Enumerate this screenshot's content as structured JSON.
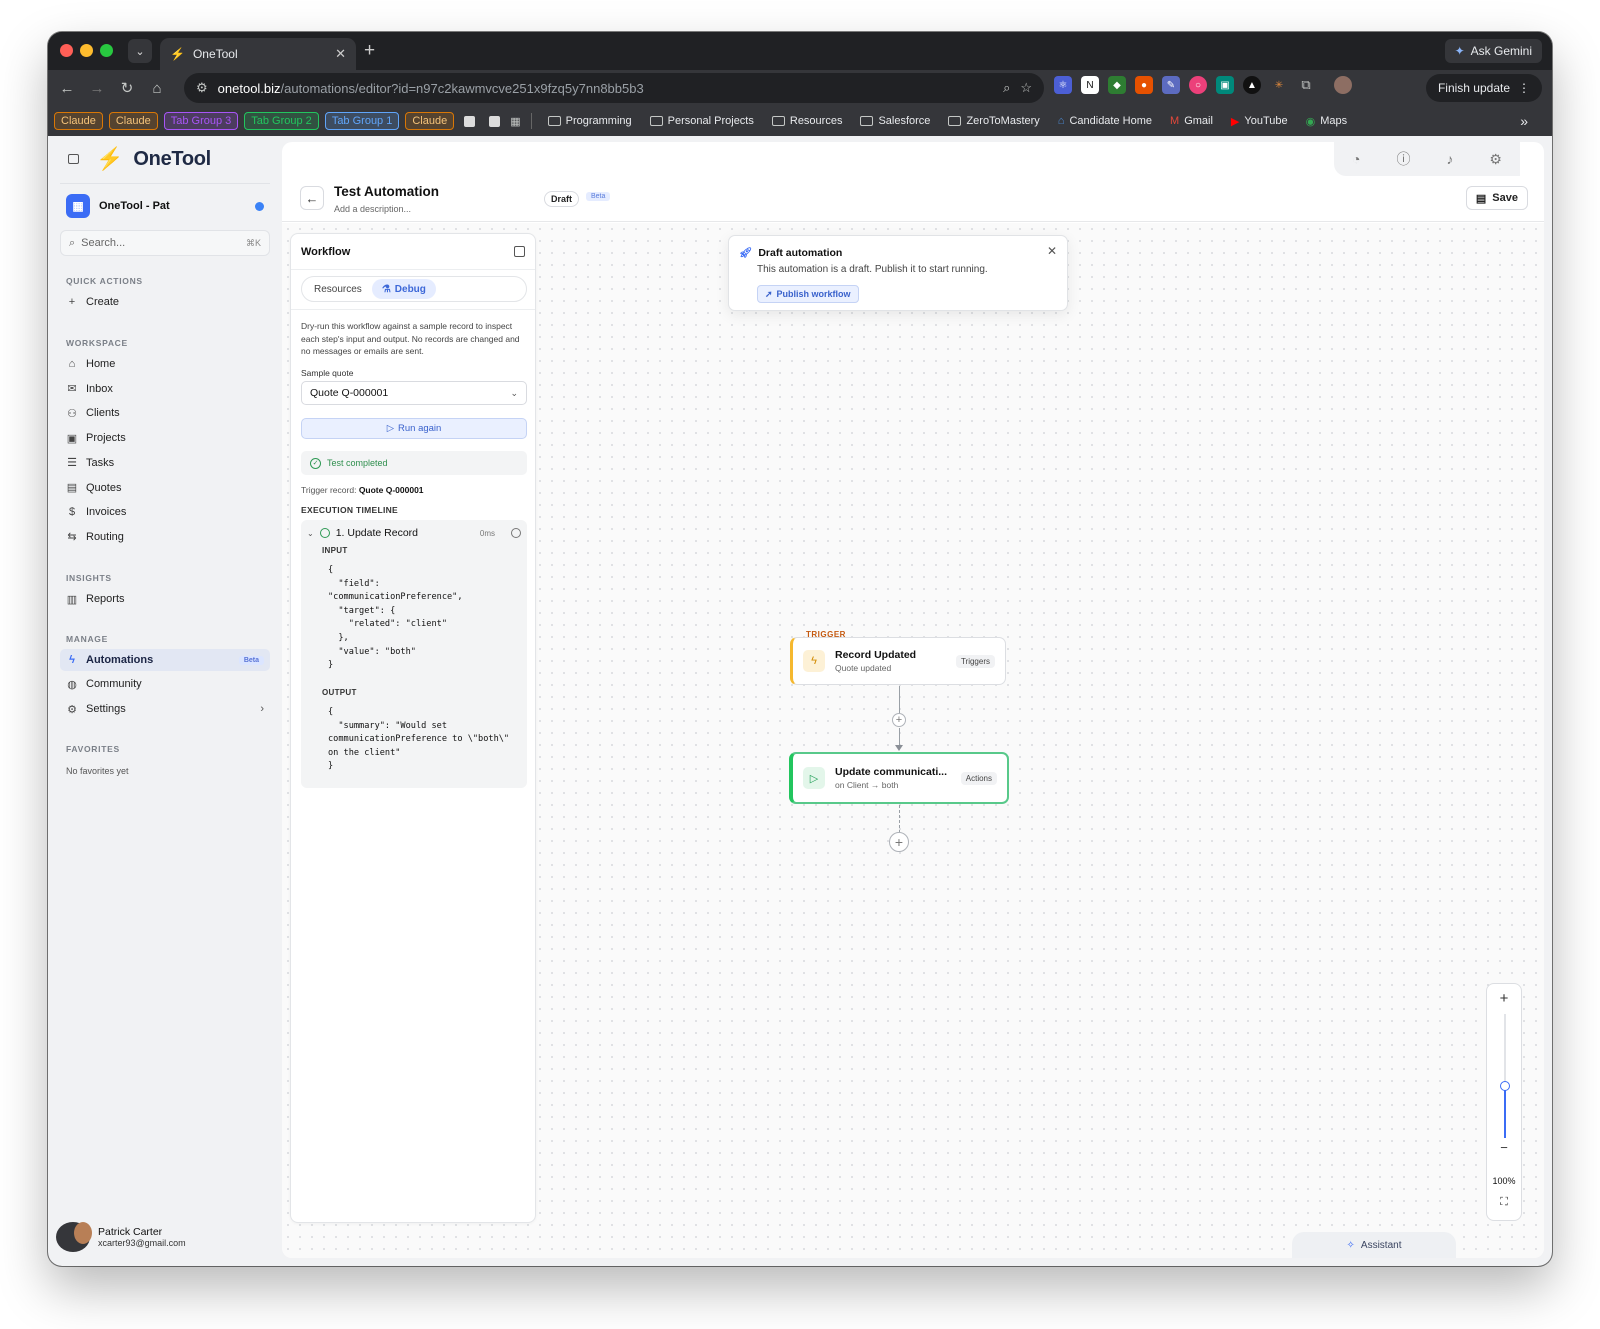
{
  "browser": {
    "tab_title": "OneTool",
    "ask_gemini": "Ask Gemini",
    "url_host": "onetool.biz",
    "url_path": "/automations/editor?id=n97c2kawmvcve251x9fzq5y7nn8bb5b3",
    "finish_update": "Finish update",
    "bookmarks": {
      "chips": [
        {
          "label": "Claude",
          "color": "#d97706"
        },
        {
          "label": "Claude",
          "color": "#d97706"
        },
        {
          "label": "Tab Group 3",
          "color": "#a855f7"
        },
        {
          "label": "Tab Group 2",
          "color": "#22c55e"
        },
        {
          "label": "Tab Group 1",
          "color": "#60a5fa"
        },
        {
          "label": "Claude",
          "color": "#d97706"
        }
      ],
      "folders": [
        "Programming",
        "Personal Projects",
        "Resources",
        "Salesforce",
        "ZeroToMastery"
      ],
      "links": [
        "Candidate Home",
        "Gmail",
        "YouTube",
        "Maps"
      ]
    }
  },
  "sidebar": {
    "brand": "OneTool",
    "org": "OneTool - Pat",
    "search_placeholder": "Search...",
    "search_kbd": "⌘K",
    "quick_actions_title": "QUICK ACTIONS",
    "create": "Create",
    "workspace_title": "WORKSPACE",
    "workspace": [
      "Home",
      "Inbox",
      "Clients",
      "Projects",
      "Tasks",
      "Quotes",
      "Invoices",
      "Routing"
    ],
    "insights_title": "INSIGHTS",
    "reports": "Reports",
    "manage_title": "MANAGE",
    "automations": "Automations",
    "automations_badge": "Beta",
    "community": "Community",
    "settings": "Settings",
    "favorites_title": "FAVORITES",
    "favorites_empty": "No favorites yet",
    "user_name": "Patrick Carter",
    "user_email": "xcarter93@gmail.com"
  },
  "header": {
    "title": "Test Automation",
    "description": "Add a description...",
    "status": "Draft",
    "badge": "Beta",
    "save": "Save"
  },
  "panel": {
    "title": "Workflow",
    "tab_resources": "Resources",
    "tab_debug": "Debug",
    "description": "Dry-run this workflow against a sample record to inspect each step's input and output. No records are changed and no messages or emails are sent.",
    "sample_label": "Sample quote",
    "sample_value": "Quote Q-000001",
    "run_again": "Run again",
    "status": "Test completed",
    "trigger_record_label": "Trigger record:",
    "trigger_record_value": "Quote Q-000001",
    "timeline_title": "EXECUTION TIMELINE",
    "step_title": "1. Update Record",
    "step_duration": "0ms",
    "input_label": "INPUT",
    "input_code": "{\n  \"field\":\n\"communicationPreference\",\n  \"target\": {\n    \"related\": \"client\"\n  },\n  \"value\": \"both\"\n}",
    "output_label": "OUTPUT",
    "output_code": "{\n  \"summary\": \"Would set\ncommunicationPreference to \\\"both\\\"\non the client\"\n}"
  },
  "banner": {
    "title": "Draft automation",
    "text": "This automation is a draft. Publish it to start running.",
    "button": "Publish workflow"
  },
  "trigger_node": {
    "section_label": "TRIGGER",
    "title": "Record Updated",
    "subtitle": "Quote updated",
    "tag": "Triggers"
  },
  "action_node": {
    "title": "Update communicati...",
    "subtitle": "on Client → both",
    "tag": "Actions"
  },
  "zoom": {
    "plus": "+",
    "minus": "−",
    "level": "100%",
    "fit": "⛶",
    "fraction": 0.42
  },
  "assistant": "Assistant",
  "colors": {
    "accent": "#3b6cf5",
    "success": "#22c55e",
    "trigger_accent": "#f5b82e"
  }
}
